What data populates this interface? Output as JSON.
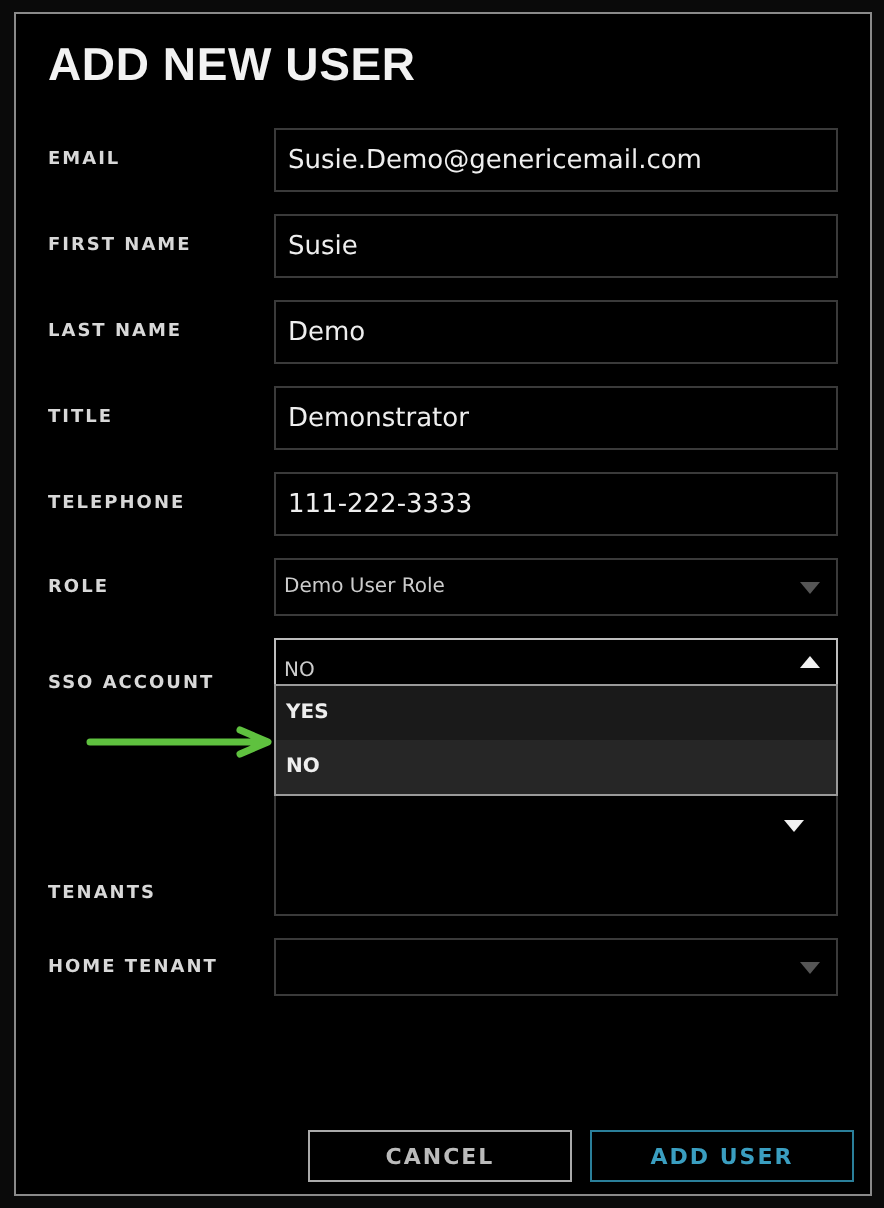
{
  "dialog": {
    "title": "ADD NEW USER"
  },
  "fields": [
    {
      "label": "EMAIL",
      "kind": "text",
      "value": "Susie.Demo@genericemail.com"
    },
    {
      "label": "FIRST NAME",
      "kind": "text",
      "value": "Susie"
    },
    {
      "label": "LAST NAME",
      "kind": "text",
      "value": "Demo"
    },
    {
      "label": "TITLE",
      "kind": "text",
      "value": "Demonstrator"
    },
    {
      "label": "TELEPHONE",
      "kind": "text",
      "value": "111-222-3333"
    },
    {
      "label": "ROLE",
      "kind": "select",
      "value": "Demo User Role",
      "expanded": false
    },
    {
      "label": "SSO ACCOUNT",
      "kind": "select",
      "value": "NO",
      "expanded": true,
      "options": [
        {
          "label": "YES",
          "selected": false
        },
        {
          "label": "NO",
          "selected": true
        }
      ]
    },
    {
      "label": "TENANTS",
      "kind": "multiselect",
      "expanded": false
    },
    {
      "label": "HOME TENANT",
      "kind": "select",
      "expanded": false
    }
  ],
  "buttons": [
    {
      "label": "CANCEL",
      "kind": "secondary"
    },
    {
      "label": "ADD USER",
      "kind": "primary"
    }
  ]
}
